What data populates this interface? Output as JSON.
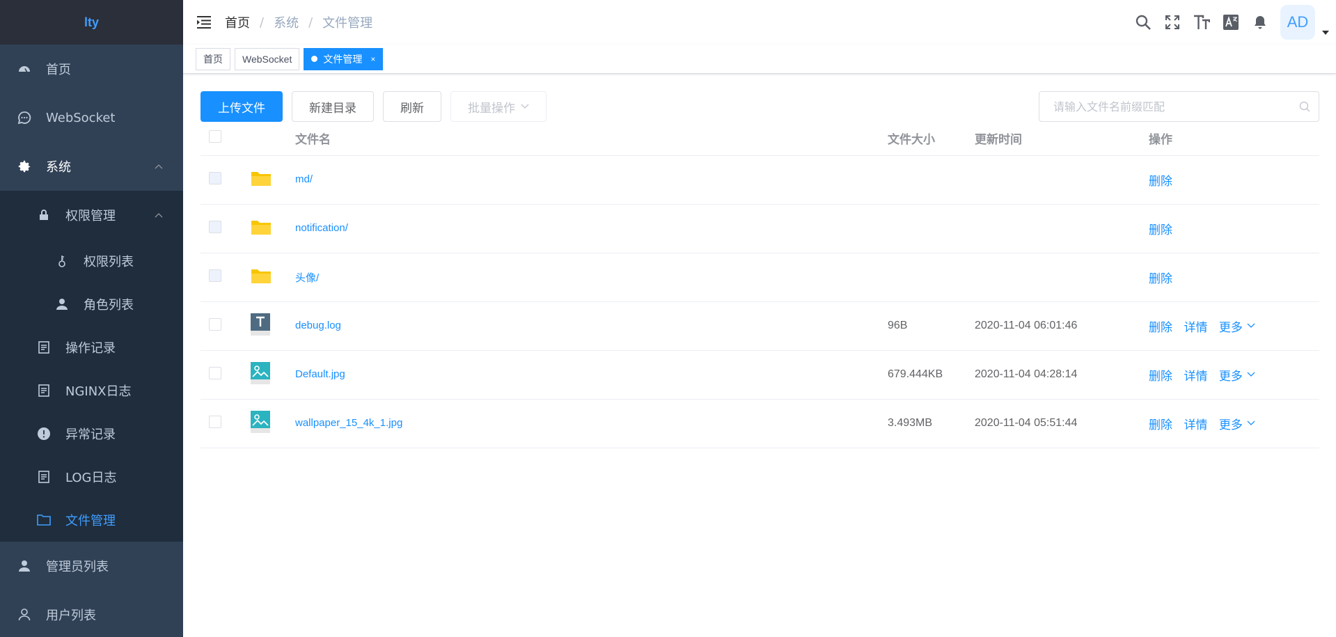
{
  "app": {
    "logo": "lty"
  },
  "sidebar": {
    "items": [
      {
        "label": "首页",
        "icon": "dashboard-icon"
      },
      {
        "label": "WebSocket",
        "icon": "message-icon"
      },
      {
        "label": "系统",
        "icon": "gear-icon"
      }
    ],
    "system_children": {
      "perm": {
        "label": "权限管理",
        "icon": "lock-icon"
      },
      "perm_children": [
        {
          "label": "权限列表",
          "icon": "key-icon"
        },
        {
          "label": "角色列表",
          "icon": "user-icon"
        }
      ],
      "others": [
        {
          "label": "操作记录",
          "icon": "document-icon"
        },
        {
          "label": "NGINX日志",
          "icon": "document-icon"
        },
        {
          "label": "异常记录",
          "icon": "warning-icon"
        },
        {
          "label": "LOG日志",
          "icon": "document-icon"
        },
        {
          "label": "文件管理",
          "icon": "folder-icon"
        }
      ]
    },
    "bottom": [
      {
        "label": "管理员列表",
        "icon": "user-icon"
      },
      {
        "label": "用户列表",
        "icon": "user-outline-icon"
      }
    ]
  },
  "navbar": {
    "breadcrumb": [
      "首页",
      "系统",
      "文件管理"
    ],
    "avatar": "AD"
  },
  "tags": [
    {
      "label": "首页"
    },
    {
      "label": "WebSocket"
    },
    {
      "label": "文件管理",
      "close": "×"
    }
  ],
  "toolbar": {
    "upload": "上传文件",
    "new_dir": "新建目录",
    "refresh": "刷新",
    "batch": "批量操作",
    "search_placeholder": "请输入文件名前缀匹配"
  },
  "table": {
    "headers": {
      "name": "文件名",
      "size": "文件大小",
      "time": "更新时间",
      "ops": "操作"
    },
    "rows": [
      {
        "type": "folder",
        "name": "md/",
        "size": "",
        "time": "",
        "ops": [
          "删除"
        ]
      },
      {
        "type": "folder",
        "name": "notification/",
        "size": "",
        "time": "",
        "ops": [
          "删除"
        ]
      },
      {
        "type": "folder",
        "name": "头像/",
        "size": "",
        "time": "",
        "ops": [
          "删除"
        ]
      },
      {
        "type": "text",
        "name": "debug.log",
        "size": "96B",
        "time": "2020-11-04 06:01:46",
        "ops": [
          "删除",
          "详情",
          "更多"
        ]
      },
      {
        "type": "image",
        "name": "Default.jpg",
        "size": "679.444KB",
        "time": "2020-11-04 04:28:14",
        "ops": [
          "删除",
          "详情",
          "更多"
        ]
      },
      {
        "type": "image",
        "name": "wallpaper_15_4k_1.jpg",
        "size": "3.493MB",
        "time": "2020-11-04 05:51:44",
        "ops": [
          "删除",
          "详情",
          "更多"
        ]
      }
    ]
  },
  "colors": {
    "primary": "#1890ff",
    "sidebar_bg": "#304156",
    "submenu_bg": "#1f2d3d",
    "folder": "#f7c600"
  }
}
